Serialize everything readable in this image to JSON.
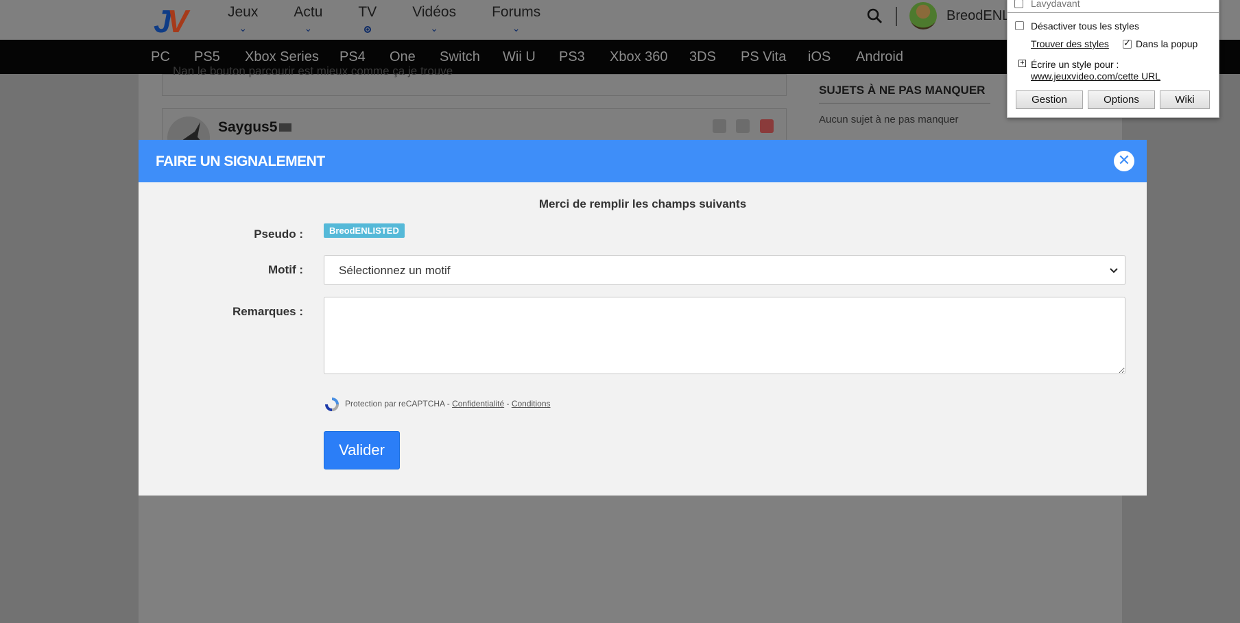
{
  "header": {
    "logo_j": "J",
    "logo_v": "V",
    "nav": [
      {
        "label": "Jeux"
      },
      {
        "label": "Actu"
      },
      {
        "label": "TV"
      },
      {
        "label": "Vidéos"
      },
      {
        "label": "Forums"
      }
    ],
    "username": "BreodENL"
  },
  "platforms": [
    "PC",
    "PS5",
    "Xbox Series",
    "PS4",
    "One",
    "Switch",
    "Wii U",
    "PS3",
    "Xbox 360",
    "3DS",
    "PS Vita",
    "iOS",
    "Android"
  ],
  "page": {
    "post_text": "Nan le bouton parcourir est mieux comme ça je trouve",
    "post_author": "Saygus5",
    "aside_title": "SUJETS À NE PAS MANQUER",
    "aside_text": "Aucun sujet à ne pas manquer"
  },
  "stylus": {
    "header": "Lavydavant",
    "disable_all": "Désactiver tous les styles",
    "find_styles": "Trouver des styles",
    "in_popup": "Dans la popup",
    "write_style": "Écrire un style pour :",
    "write_style_url": "www.jeuxvideo.com/cette URL",
    "manage": "Gestion",
    "options": "Options",
    "wiki": "Wiki"
  },
  "modal": {
    "title": "FAIRE UN SIGNALEMENT",
    "intro": "Merci de remplir les champs suivants",
    "pseudo_label": "Pseudo :",
    "pseudo_value": "BreodENLISTED",
    "motif_label": "Motif :",
    "motif_value": "Sélectionnez un motif",
    "remarks_label": "Remarques :",
    "remarks_value": "",
    "recaptcha_text": "Protection par reCAPTCHA -",
    "recaptcha_sep": "-",
    "privacy": "Confidentialité",
    "terms": "Conditions",
    "submit": "Valider"
  },
  "colors": {
    "modal_header": "#3e8ef9",
    "submit": "#2b7ef7",
    "badge": "#55b9d8"
  }
}
